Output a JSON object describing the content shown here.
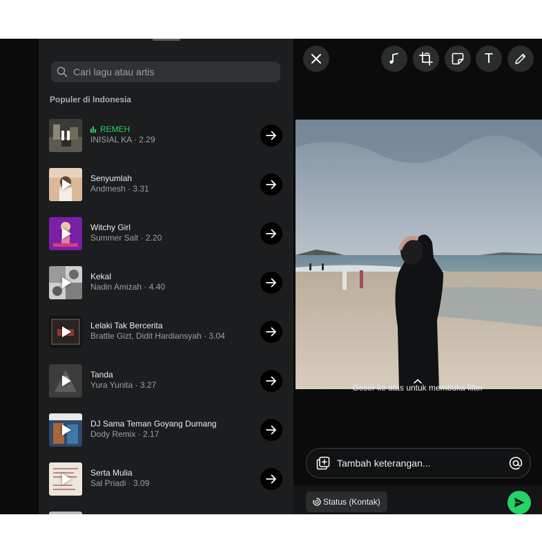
{
  "music_panel": {
    "search_placeholder": "Cari lagu atau artis",
    "section_title": "Populer di Indonesia",
    "songs": [
      {
        "title": "REMEH",
        "artist": "INISIAL KA",
        "duration": "2.29",
        "playing": true
      },
      {
        "title": "Senyumlah",
        "artist": "Andmesh",
        "duration": "3.31",
        "playing": false
      },
      {
        "title": "Witchy Girl",
        "artist": "Summer Salt",
        "duration": "2.20",
        "playing": false
      },
      {
        "title": "Kekal",
        "artist": "Nadin Amizah",
        "duration": "4.40",
        "playing": false
      },
      {
        "title": "Lelaki Tak Bercerita",
        "artist": "Brattle Gizt, Didit Hardiansyah",
        "duration": "3.04",
        "playing": false
      },
      {
        "title": "Tanda",
        "artist": "Yura Yunita",
        "duration": "3.27",
        "playing": false
      },
      {
        "title": "DJ Sama Teman Goyang Dumang",
        "artist": "Dody Remix",
        "duration": "2.17",
        "playing": false
      },
      {
        "title": "Serta Mulia",
        "artist": "Sal Priadi",
        "duration": "3.09",
        "playing": false
      }
    ],
    "separator": "·"
  },
  "editor": {
    "toolbar": [
      "close-icon",
      "music-note-icon",
      "crop-rotate-icon",
      "sticker-icon",
      "text-icon",
      "pencil-icon"
    ],
    "text_tool_label": "T",
    "swipe_hint": "Geser ke atas untuk membuka filter",
    "caption_placeholder": "Tambah keterangan...",
    "status_label": "Status (Kontak)",
    "accent_color": "#25d366"
  }
}
